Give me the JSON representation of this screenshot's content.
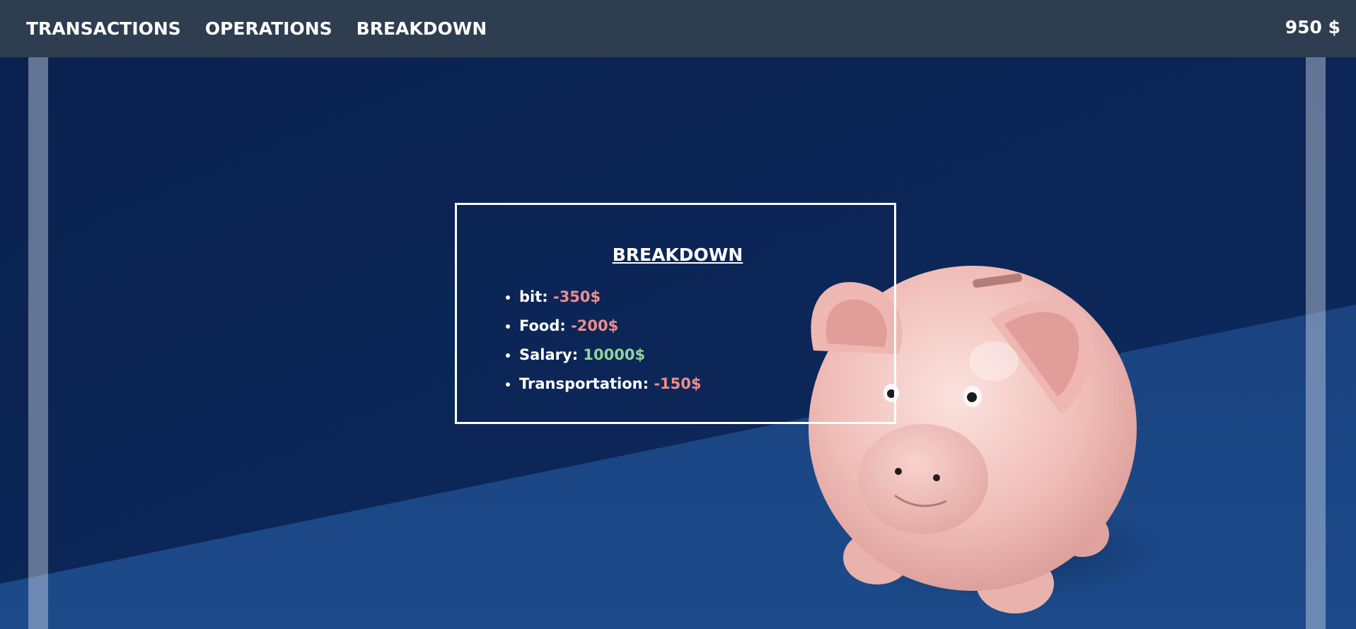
{
  "nav": {
    "links": [
      "TRANSACTIONS",
      "OPERATIONS",
      "BREAKDOWN"
    ],
    "balance": "950 $"
  },
  "breakdown": {
    "title": "BREAKDOWN",
    "items": [
      {
        "label": "bit:",
        "amount": "-350$",
        "type": "negative"
      },
      {
        "label": "Food:",
        "amount": "-200$",
        "type": "negative"
      },
      {
        "label": "Salary:",
        "amount": "10000$",
        "type": "positive"
      },
      {
        "label": "Transportation:",
        "amount": "-150$",
        "type": "negative"
      }
    ]
  },
  "colors": {
    "navbar": "#2e3e50",
    "negative": "#f08c8c",
    "positive": "#8fd49a",
    "wall": "#0b2452",
    "floor": "#1a4480",
    "piggy": "#f2c4c0"
  }
}
